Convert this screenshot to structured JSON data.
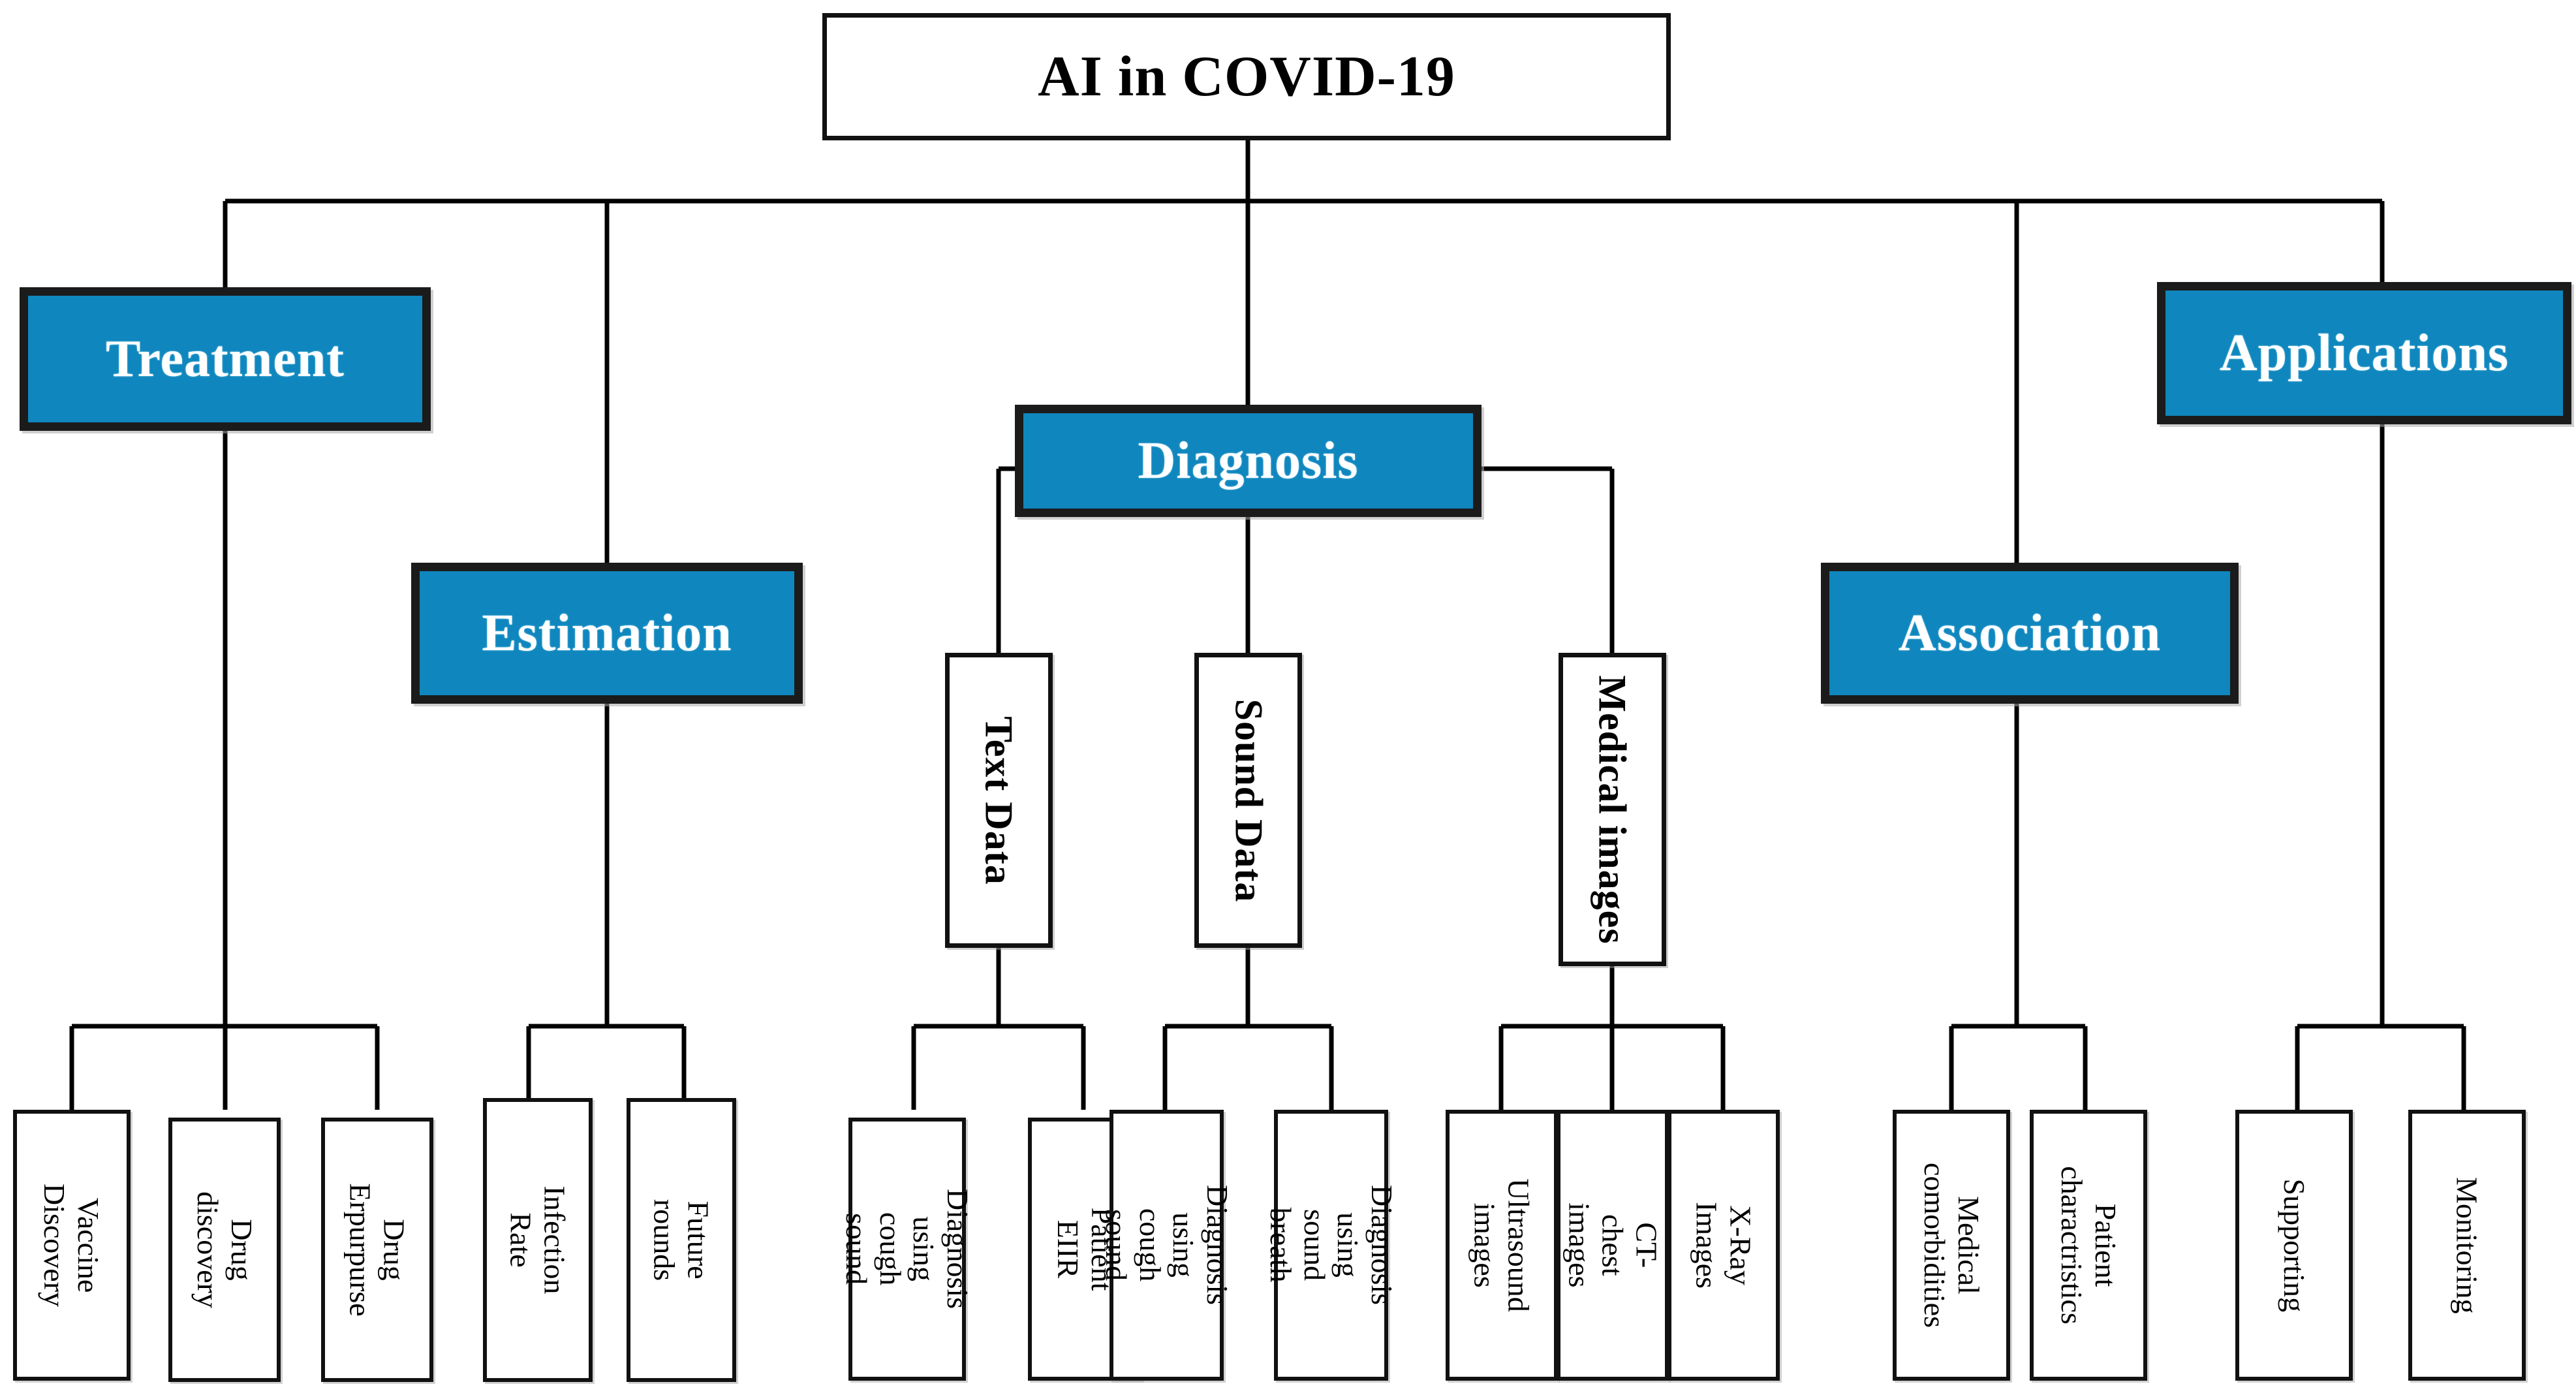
{
  "diagram": {
    "title": "AI in COVID-19",
    "root": {
      "label": "AI in COVID-19"
    },
    "colors": {
      "category_fill": "#0f86bd",
      "category_text": "#ffffff",
      "box_border": "#111111",
      "page_background": "#ffffff",
      "connector": "#000000"
    },
    "categories": {
      "treatment": {
        "label": "Treatment"
      },
      "estimation": {
        "label": "Estimation"
      },
      "diagnosis": {
        "label": "Diagnosis"
      },
      "association": {
        "label": "Association"
      },
      "applications": {
        "label": "Applications"
      }
    },
    "mid": {
      "text_data": {
        "label": "Text Data"
      },
      "sound_data": {
        "label": "Sound Data"
      },
      "medical_images": {
        "label": "Medical images"
      }
    },
    "leaves": {
      "vaccine_discovery": {
        "label": "Vaccine\nDiscovery"
      },
      "drug_discovery": {
        "label": "Drug discovery"
      },
      "drug_erpurpurse": {
        "label": "Drug Erpurpurse"
      },
      "infection_rate": {
        "label": "Infection Rate"
      },
      "future_rounds": {
        "label": "Future rounds"
      },
      "diagnosis_cough_text": {
        "label": "Diagnosis using\ncough sound"
      },
      "patient_ehr": {
        "label": "Patient EIIR"
      },
      "diagnosis_cough_sound": {
        "label": "Diagnosis using\ncough sound"
      },
      "diagnosis_sound_breath": {
        "label": "Diagnosis using\nsound breath"
      },
      "ultrasound_images": {
        "label": "Ultrasound\nimages"
      },
      "ct_chest_images": {
        "label": "CT-chest\nimages"
      },
      "xray_images": {
        "label": "X-Ray Images"
      },
      "medical_comorbidities": {
        "label": "Medical\ncomorbidities"
      },
      "patient_charactristics": {
        "label": "Patient\ncharactristics"
      },
      "supporting": {
        "label": "Supporting"
      },
      "monitoring": {
        "label": "Monitoring"
      }
    }
  }
}
